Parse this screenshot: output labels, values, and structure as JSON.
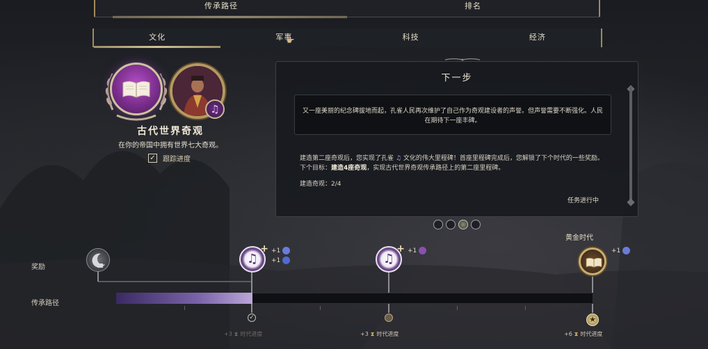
{
  "top_tabs": [
    {
      "label": "传承路径",
      "active": true
    },
    {
      "label": "排名",
      "active": false
    }
  ],
  "category_tabs": [
    {
      "label": "文化",
      "active": true
    },
    {
      "label": "军事",
      "active": false
    },
    {
      "label": "科技",
      "active": false
    },
    {
      "label": "经济",
      "active": false
    }
  ],
  "legacy": {
    "title": "古代世界奇观",
    "description": "在你的帝国中拥有世界七大奇观。",
    "track_label": "跟踪进度",
    "track_checked": true,
    "emblem_icon": "book-icon",
    "leader_badge_icon": "music-note-icon"
  },
  "panel": {
    "title": "下一步",
    "quote": "又一座美丽的纪念碑拔地而起，孔雀人民再次维护了自己作为奇观建设者的声誉。但声誉需要不断强化。人民在期待下一座丰碑。",
    "body_line1": "建造第二座奇观后，您实现了孔雀",
    "body_line1_icon": "music-note-icon",
    "body_line1_tail": "文化的伟大里程碑！首座里程碑完成后，您解锁了下个时代的一些奖励。",
    "goal_prefix": "下个目标：",
    "goal_bold": "建造4座奇观",
    "goal_tail": "，实现古代世界奇观传承路径上的第二座里程碑。",
    "progress_label": "建造奇观：2/4",
    "status": "任务进行中"
  },
  "pager": {
    "count": 4,
    "active_index": 2
  },
  "timeline": {
    "rewards_label": "奖励",
    "path_label": "传承路径",
    "golden_age_label": "黄金时代",
    "progress_fraction": 0.285,
    "nodes": [
      {
        "icon": "moon-lock-icon",
        "rewards": []
      },
      {
        "icon": "music-note-icon",
        "rewards": [
          {
            "text": "+1",
            "icon": "attribute-icon",
            "color": "#6a7bd8"
          },
          {
            "text": "+1",
            "icon": "culture-icon",
            "color": "#4f6ad0"
          }
        ]
      },
      {
        "icon": "music-note-icon",
        "rewards": [
          {
            "text": "+1",
            "icon": "wonder-icon",
            "color": "#8a4fb0"
          }
        ]
      },
      {
        "icon": "book-icon",
        "rewards": [
          {
            "text": "+1",
            "icon": "attribute-icon",
            "color": "#6a7bd8"
          }
        ]
      }
    ],
    "era_tags": [
      {
        "text": "+3",
        "suffix": "时代进度",
        "dim": true
      },
      {
        "text": "+3",
        "suffix": "时代进度",
        "dim": false
      },
      {
        "text": "+6",
        "suffix": "时代进度",
        "dim": false
      }
    ]
  },
  "colors": {
    "accent_gold": "#b59960",
    "purple": "#7a2e8c",
    "progress_fill": "#7a63a8"
  }
}
